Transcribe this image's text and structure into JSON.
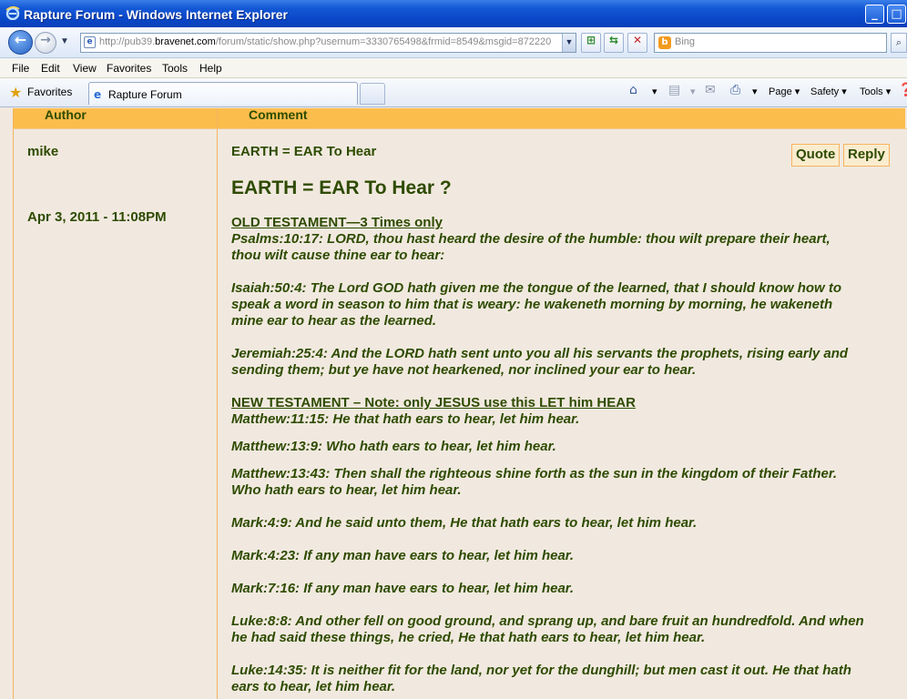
{
  "window": {
    "title": "Rapture Forum - Windows Internet Explorer"
  },
  "address": {
    "prefix": "http://pub39.",
    "host": "bravenet.com",
    "path": "/forum/static/show.php?usernum=3330765498&frmid=8549&msgid=872220"
  },
  "search": {
    "placeholder": "Bing"
  },
  "menu": [
    "File",
    "Edit",
    "View",
    "Favorites",
    "Tools",
    "Help"
  ],
  "favorites": {
    "label": "Favorites"
  },
  "tab": {
    "title": "Rapture Forum"
  },
  "commands": {
    "page": "Page ▾",
    "safety": "Safety ▾",
    "tools": "Tools ▾"
  },
  "forum": {
    "columns": {
      "author": "Author",
      "comment": "Comment"
    },
    "post": {
      "author": "mike",
      "date": "Apr 3, 2011 - 11:08PM",
      "subject": "EARTH = EAR To Hear",
      "quote_label": "Quote",
      "reply_label": "Reply",
      "heading": "EARTH = EAR To Hear ?",
      "ot_heading": "OLD TESTAMENT—3 Times only",
      "ot_verses": [
        {
          "l1": "Psalms:10:17: LORD, thou hast heard the desire of the humble: thou wilt prepare their heart,",
          "l2": "thou wilt cause thine ear to hear:",
          "l3": ""
        },
        {
          "l1": "Isaiah:50:4: The Lord GOD hath given me the tongue of the learned, that I should know how to",
          "l2": "speak a word in season to him that is weary: he wakeneth morning by morning, he wakeneth",
          "l3": "mine ear to hear as the learned."
        },
        {
          "l1": "Jeremiah:25:4: And the LORD hath sent unto you all his servants the prophets, rising early and",
          "l2": "sending them; but ye have not hearkened, nor inclined your ear to hear.",
          "l3": ""
        }
      ],
      "nt_heading": "NEW TESTAMENT – Note: only JESUS use this LET him HEAR",
      "nt_verses": [
        {
          "l1": "Matthew:11:15: He that hath ears to hear, let him hear.",
          "l2": ""
        },
        {
          "l1": "Matthew:13:9: Who hath ears to hear, let him hear.",
          "l2": ""
        },
        {
          "l1": "Matthew:13:43: Then shall the righteous shine forth as the sun in the kingdom of their Father.",
          "l2": "Who hath ears to hear, let him hear."
        },
        {
          "l1": "Mark:4:9: And he said unto them, He that hath ears to hear, let him hear.",
          "l2": ""
        },
        {
          "l1": "Mark:4:23: If any man have ears to hear, let him hear.",
          "l2": ""
        },
        {
          "l1": "Mark:7:16: If any man have ears to hear, let him hear.",
          "l2": ""
        },
        {
          "l1": "Luke:8:8: And other fell on good ground, and sprang up, and bare fruit an hundredfold. And when",
          "l2": "he had said these things, he cried, He that hath ears to hear, let him hear."
        },
        {
          "l1": "Luke:14:35: It is neither fit for the land, nor yet for the dunghill; but men cast it out. He that hath",
          "l2": "ears to hear, let him hear."
        }
      ]
    }
  },
  "colors": {
    "header": "#fbbd4c",
    "text": "#2e4b00",
    "background": "#f1e9df"
  }
}
